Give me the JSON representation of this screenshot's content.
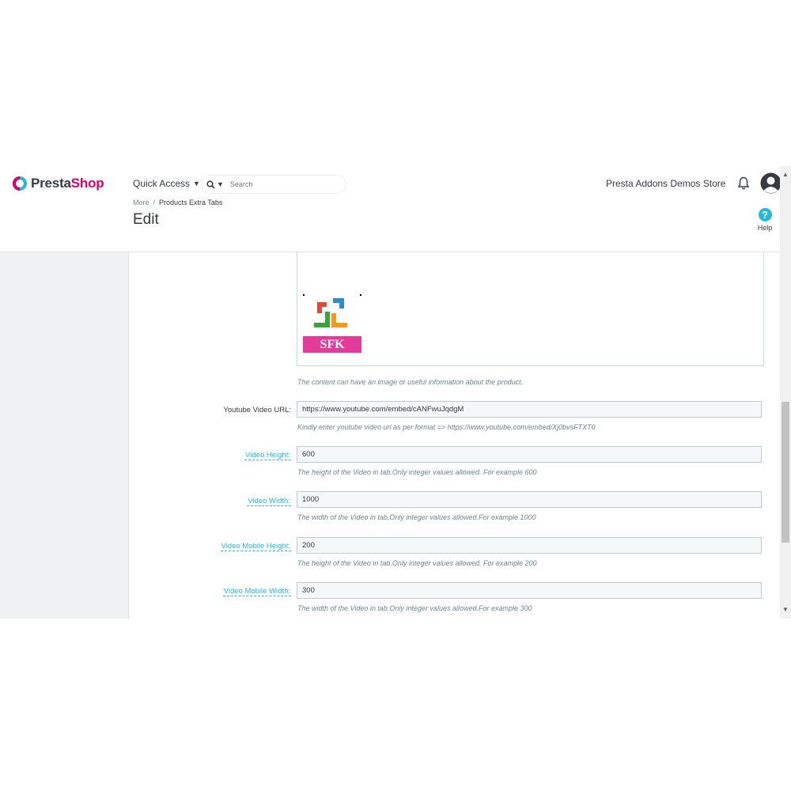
{
  "header": {
    "logo_text_1": "Presta",
    "logo_text_2": "Shop",
    "quick_access": "Quick Access",
    "search_placeholder": "Search",
    "store_name": "Presta Addons Demos Store",
    "help_label": "Help",
    "help_symbol": "?"
  },
  "breadcrumb": {
    "parent": "More",
    "separator": "/",
    "current": "Products Extra Tabs"
  },
  "page_title": "Edit",
  "editor": {
    "image_text": "SFK",
    "hint": "The content can have an image or useful information about the product."
  },
  "form": {
    "fields": [
      {
        "label": "Youtube Video URL:",
        "value": "https://www.youtube.com/embed/cANFwuJqdgM",
        "hint": "Kindly enter youtube video url as per format => https://www.youtube.com/embed/Xj0bvsFTXT0",
        "tooltip": false
      },
      {
        "label": "Video Height:",
        "value": "600",
        "hint": "The height of the Video in tab.Only integer values allowed. For example 600",
        "tooltip": true
      },
      {
        "label": "Video Width:",
        "value": "1000",
        "hint": "The width of the Video in tab.Only integer values allowed.For example 1000",
        "tooltip": true
      },
      {
        "label": "Video Mobile Height:",
        "value": "200",
        "hint": "The height of the Video in tab.Only integer values allowed. For example 200",
        "tooltip": true
      },
      {
        "label": "Video Mobile Width:",
        "value": "300",
        "hint": "The width of the Video in tab.Only integer values allowed.For example 300",
        "tooltip": true
      }
    ]
  },
  "colors": {
    "brand_pink": "#df0067",
    "brand_blue": "#25b9d7",
    "text": "#363a41",
    "hint": "#6c868e",
    "sfk_band": "#e43a9a"
  },
  "icons": [
    "logo-icon",
    "caret-down-icon",
    "search-icon",
    "bell-icon",
    "avatar-icon",
    "help-icon",
    "scroll-up-arrow-icon",
    "scroll-down-arrow-icon"
  ]
}
